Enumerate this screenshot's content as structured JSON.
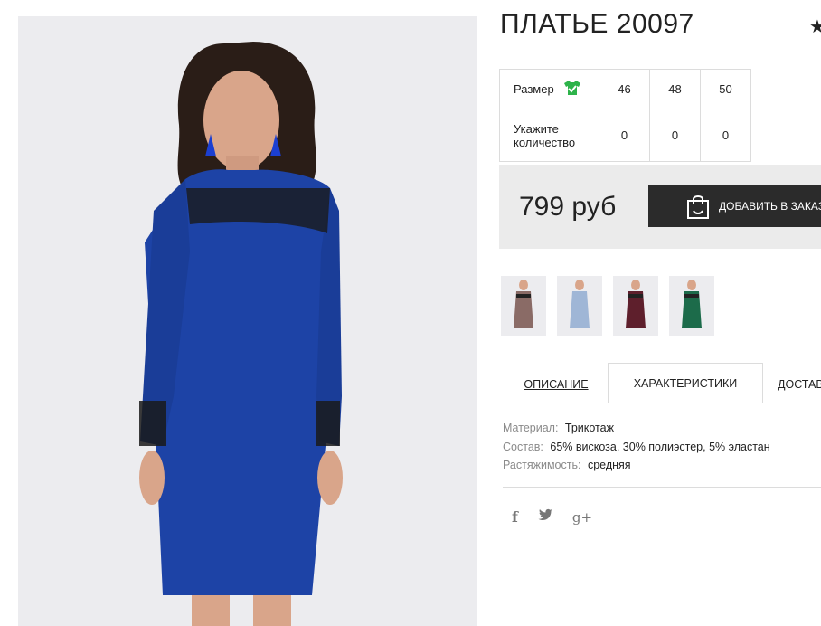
{
  "product": {
    "title": "ПЛАТЬЕ 20097",
    "star_icon": "★"
  },
  "sizes": {
    "size_label": "Размер",
    "qty_label": "Укажите количество",
    "columns": [
      "46",
      "48",
      "50"
    ],
    "quantities": [
      "0",
      "0",
      "0"
    ]
  },
  "price": {
    "value": "799 руб",
    "button_label": "ДОБАВИТЬ В ЗАКАЗ"
  },
  "thumbnails": [
    "#8a6b66",
    "#9fb6d6",
    "#5e1f2c",
    "#1c6b4a"
  ],
  "tabs": [
    {
      "label": "ОПИСАНИЕ"
    },
    {
      "label": "ХАРАКТЕРИСТИКИ"
    },
    {
      "label": "ДОСТАВКА"
    }
  ],
  "specs": [
    {
      "key": "Материал:",
      "value": "Трикотаж"
    },
    {
      "key": "Состав:",
      "value": "65% вискоза, 30% полиэстер, 5% эластан"
    },
    {
      "key": "Растяжимость:",
      "value": "средняя"
    }
  ],
  "social": {
    "facebook": "f",
    "twitter_icon": "twitter-icon",
    "gplus": "g+"
  },
  "colors": {
    "dress": "#1d43a6",
    "button": "#2b2b2b",
    "price_bg": "#ebebeb",
    "size_icon": "#2db34a"
  }
}
